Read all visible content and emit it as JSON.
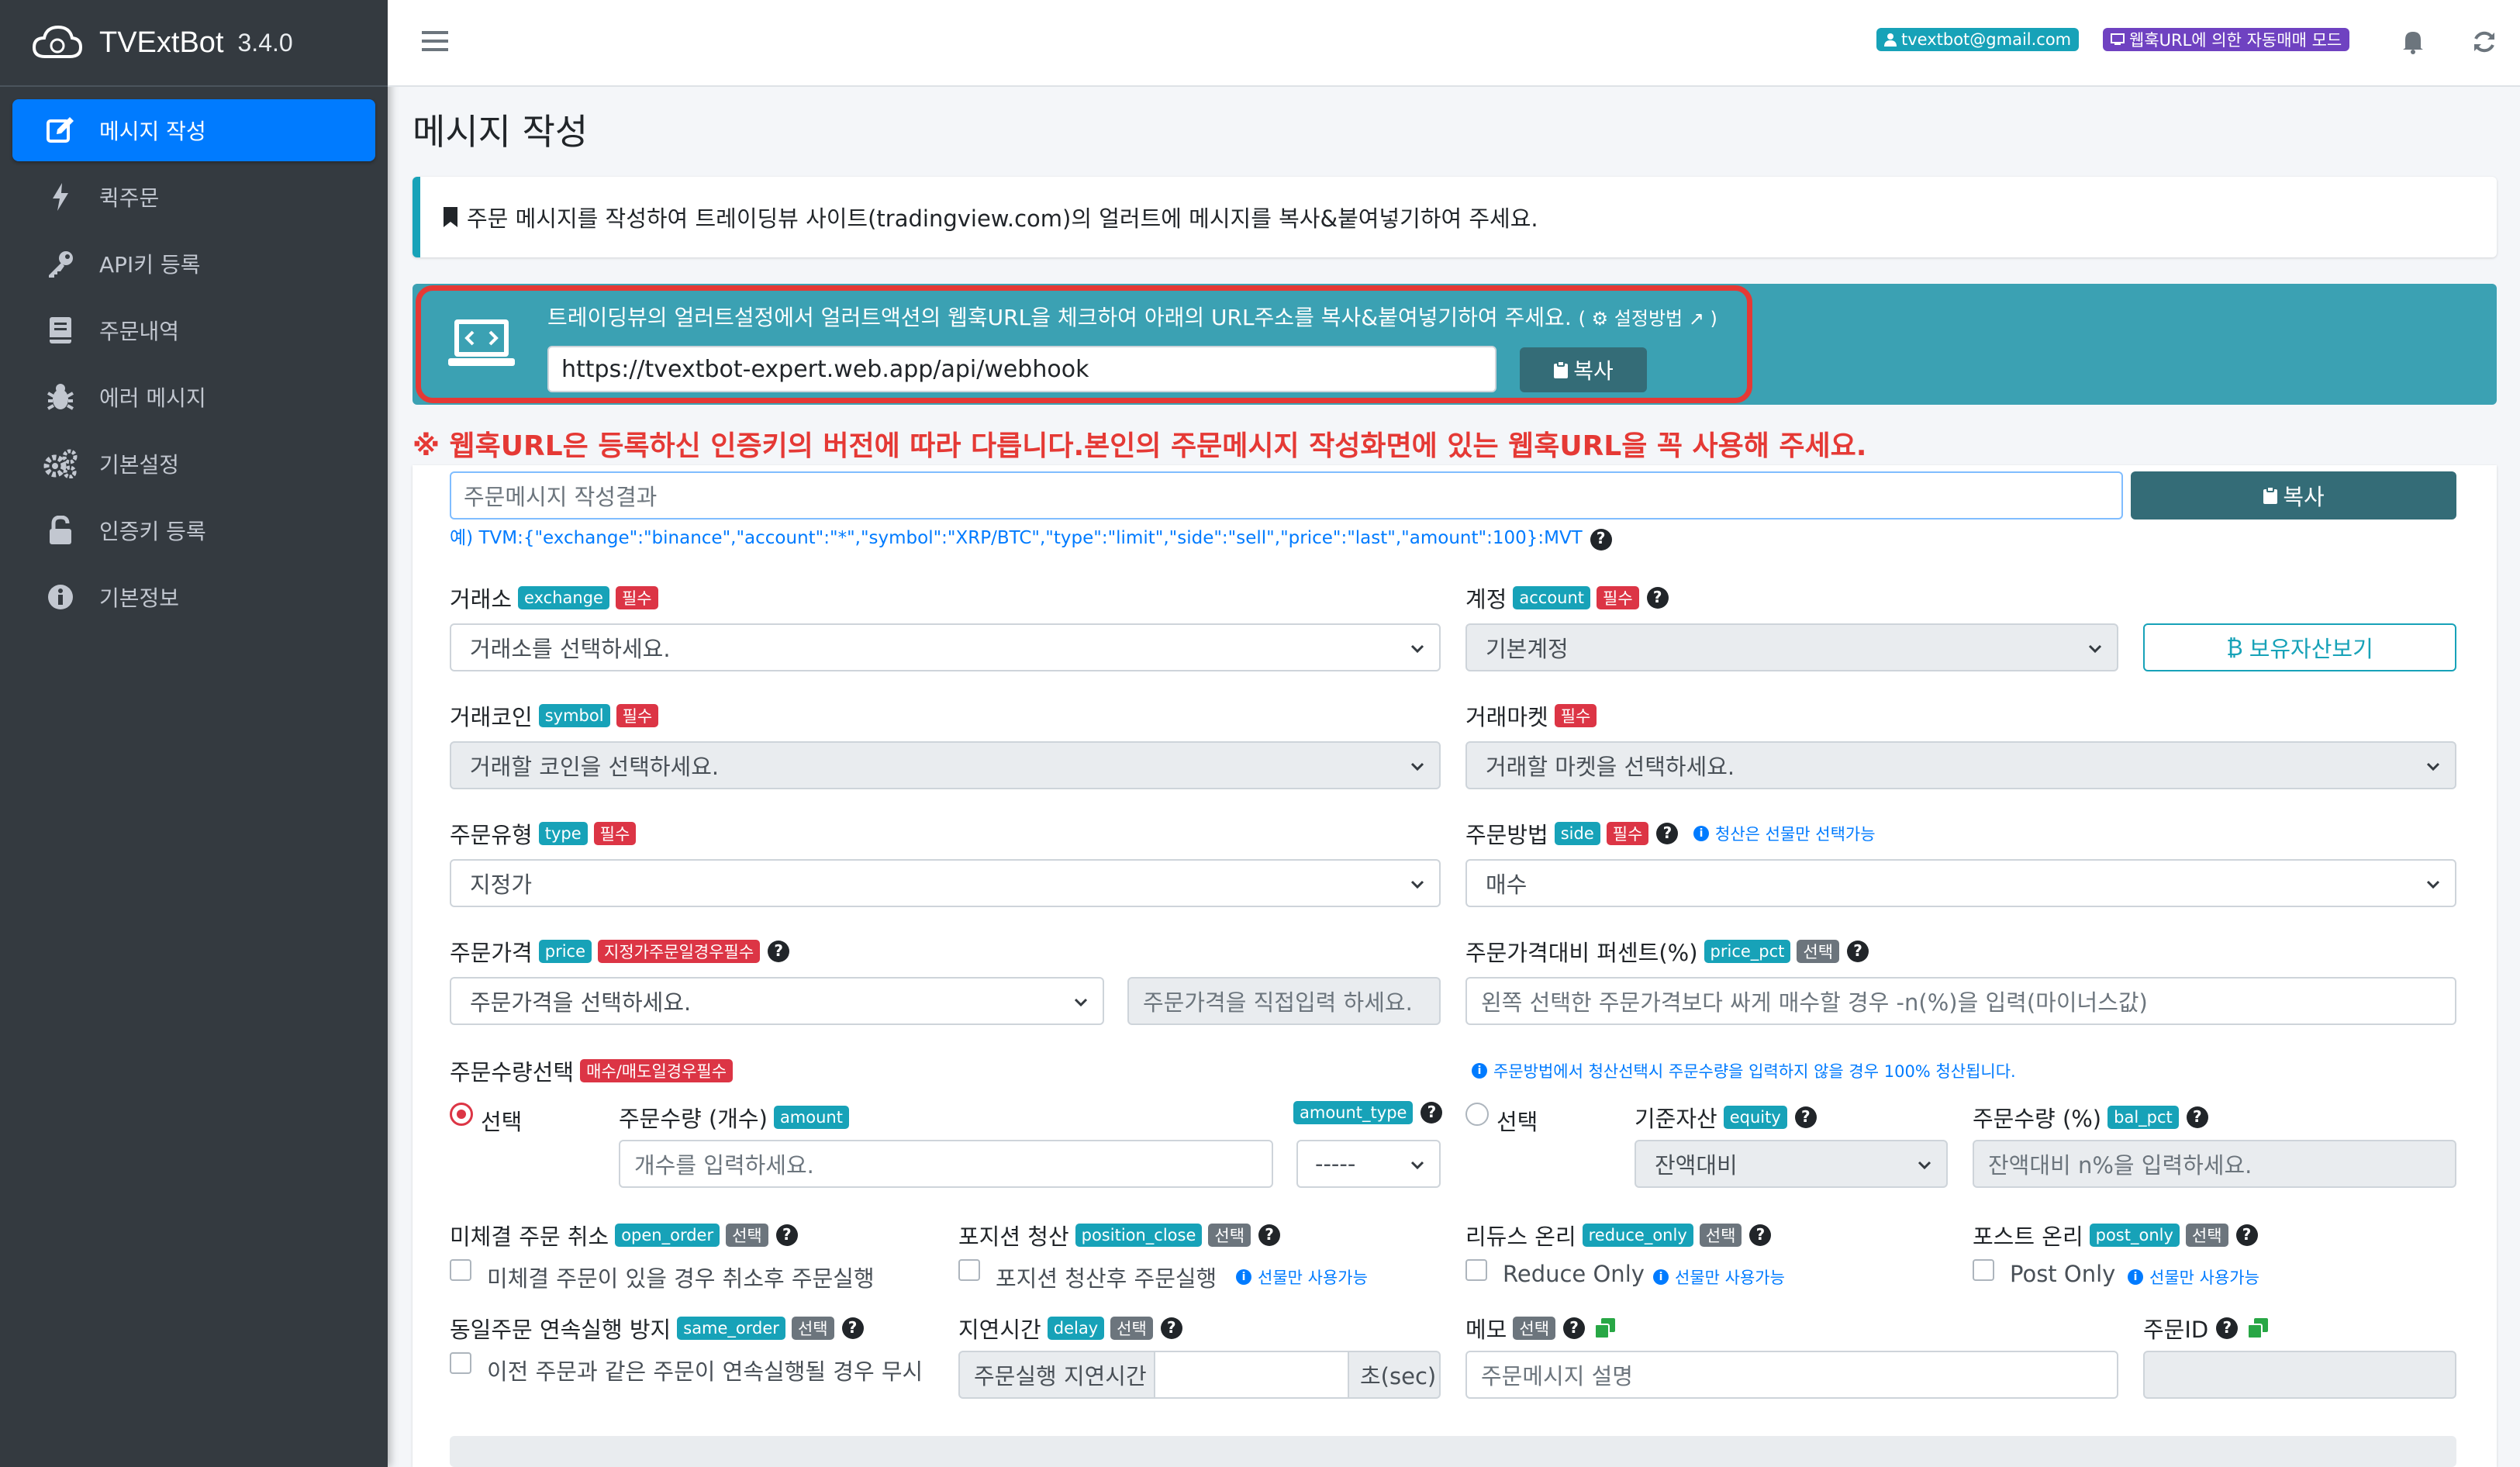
{
  "app": {
    "name": "TVExtBot",
    "version": "3.4.0"
  },
  "sidebar": {
    "items": [
      {
        "label": "메시지 작성",
        "icon": "edit-icon",
        "active": true
      },
      {
        "label": "퀵주문",
        "icon": "bolt-icon"
      },
      {
        "label": "API키 등록",
        "icon": "key-icon"
      },
      {
        "label": "주문내역",
        "icon": "book-icon"
      },
      {
        "label": "에러 메시지",
        "icon": "bug-icon"
      },
      {
        "label": "기본설정",
        "icon": "cogs-icon"
      },
      {
        "label": "인증키 등록",
        "icon": "unlock-icon"
      },
      {
        "label": "기본정보",
        "icon": "info-icon"
      }
    ]
  },
  "topbar": {
    "email": "tvextbot@gmail.com",
    "mode": "웹훅URL에 의한 자동매매 모드"
  },
  "page": {
    "title": "메시지 작성",
    "callout": "주문 메시지를 작성하여 트레이딩뷰 사이트(tradingview.com)의 얼러트에 메시지를 복사&붙여넣기하여 주세요."
  },
  "webhook": {
    "instruction": "트레이딩뷰의 얼러트설정에서 얼러트액션의 웹훅URL을 체크하여 아래의 URL주소를 복사&붙여넣기하여 주세요.",
    "how_label": "설정방법",
    "url": "https://tvextbot-expert.web.app/api/webhook",
    "copy_label": "복사"
  },
  "warning": "※ 웹훅URL은 등록하신 인증키의 버전에 따라 다릅니다.본인의 주문메시지 작성화면에 있는 웹훅URL을 꼭 사용해 주세요.",
  "result": {
    "placeholder": "주문메시지 작성결과",
    "copy_label": "복사",
    "example": "예) TVM:{\"exchange\":\"binance\",\"account\":\"*\",\"symbol\":\"XRP/BTC\",\"type\":\"limit\",\"side\":\"sell\",\"price\":\"last\",\"amount\":100}:MVT"
  },
  "badges": {
    "required": "필수",
    "optional": "선택",
    "limit_required": "지정가주문일경우필수",
    "buysell_required": "매수/매도일경우필수"
  },
  "form": {
    "exchange": {
      "label": "거래소",
      "key": "exchange",
      "value": "거래소를 선택하세요."
    },
    "account": {
      "label": "계정",
      "key": "account",
      "value": "기본계정",
      "assets_button": "보유자산보기"
    },
    "symbol": {
      "label": "거래코인",
      "key": "symbol",
      "value": "거래할 코인을 선택하세요."
    },
    "market": {
      "label": "거래마켓",
      "value": "거래할 마켓을 선택하세요."
    },
    "type": {
      "label": "주문유형",
      "key": "type",
      "value": "지정가"
    },
    "side": {
      "label": "주문방법",
      "key": "side",
      "value": "매수",
      "note": "청산은 선물만 선택가능"
    },
    "price": {
      "label": "주문가격",
      "key": "price",
      "value": "주문가격을 선택하세요.",
      "direct_placeholder": "주문가격을 직접입력 하세요."
    },
    "price_pct": {
      "label": "주문가격대비 퍼센트(%)",
      "key": "price_pct",
      "placeholder": "왼쪽 선택한 주문가격보다 싸게 매수할 경우 -n(%)을 입력(마이너스값)"
    },
    "qty_select": {
      "label": "주문수량선택",
      "note": "주문방법에서 청산선택시 주문수량을 입력하지 않을 경우 100% 청산됩니다.",
      "radio_label": "선택"
    },
    "amount": {
      "label": "주문수량 (개수)",
      "key": "amount",
      "placeholder": "개수를 입력하세요."
    },
    "amount_type": {
      "key": "amount_type",
      "value": "-----"
    },
    "equity": {
      "label": "기준자산",
      "key": "equity",
      "value": "잔액대비"
    },
    "bal_pct": {
      "label": "주문수량 (%)",
      "key": "bal_pct",
      "placeholder": "잔액대비 n%을 입력하세요."
    },
    "open_order": {
      "label": "미체결 주문 취소",
      "key": "open_order",
      "check": "미체결 주문이 있을 경우 취소후 주문실행"
    },
    "position_close": {
      "label": "포지션 청산",
      "key": "position_close",
      "check": "포지션 청산후 주문실행",
      "note": "선물만 사용가능"
    },
    "reduce_only": {
      "label": "리듀스 온리",
      "key": "reduce_only",
      "check": "Reduce Only",
      "note": "선물만 사용가능"
    },
    "post_only": {
      "label": "포스트 온리",
      "key": "post_only",
      "check": "Post Only",
      "note": "선물만 사용가능"
    },
    "same_order": {
      "label": "동일주문 연속실행 방지",
      "key": "same_order",
      "check": "이전 주문과 같은 주문이 연속실행될 경우 무시"
    },
    "delay": {
      "label": "지연시간",
      "key": "delay",
      "prefix": "주문실행 지연시간",
      "suffix": "초(sec)"
    },
    "memo": {
      "label": "메모",
      "placeholder": "주문메시지 설명"
    },
    "order_id": {
      "label": "주문ID"
    }
  },
  "colors": {
    "sidebar": "#343a40",
    "active": "#007bff",
    "info": "#17a2b8",
    "danger": "#dc3545",
    "webhook_bg": "#3ba1b3",
    "copy_btn": "#346c77",
    "warning": "#e53935"
  }
}
